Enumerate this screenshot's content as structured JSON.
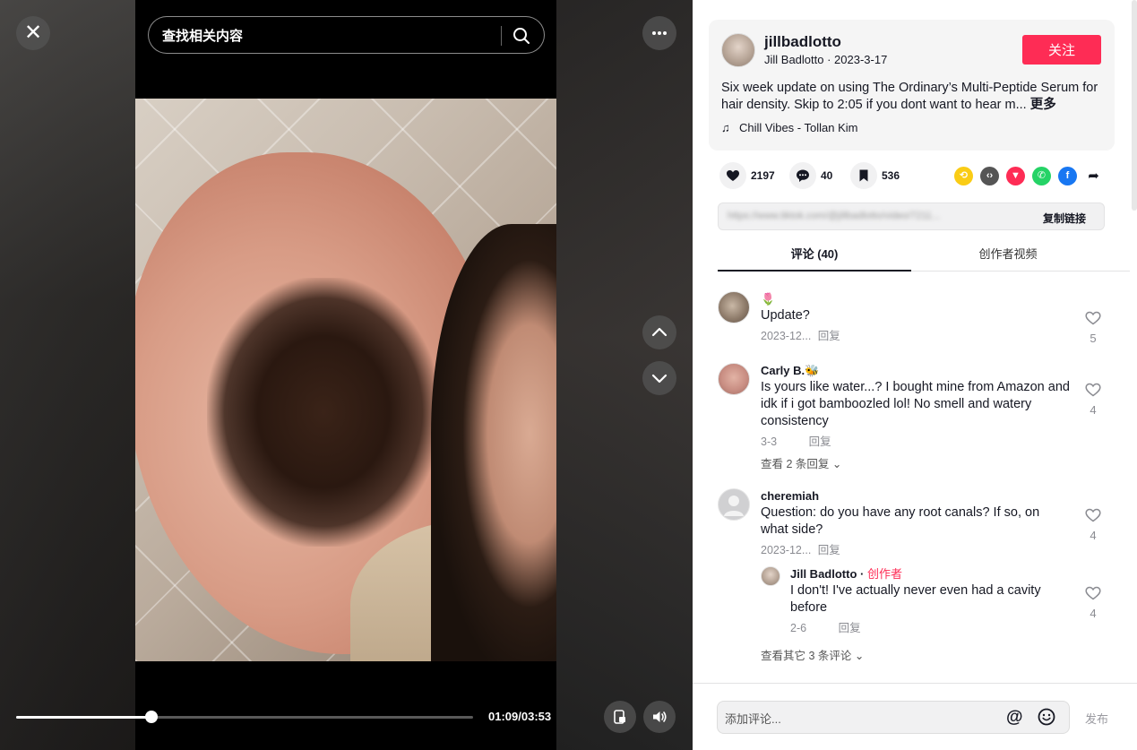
{
  "player": {
    "search_placeholder": "查找相关内容",
    "time": "01:09/03:53",
    "progress": 0.297
  },
  "author": {
    "username": "jillbadlotto",
    "subline": "Jill Badlotto · 2023-3-17",
    "follow_label": "关注",
    "description": "Six week update on using The Ordinary’s Multi-Peptide Serum for hair density. Skip to 2:05 if you dont want to hear m...",
    "more_label": "更多",
    "music": "Chill Vibes - Tollan Kim"
  },
  "stats": {
    "likes": "2197",
    "comments": "40",
    "saves": "536"
  },
  "share_icons": [
    {
      "name": "repost-icon",
      "color": "#facc15"
    },
    {
      "name": "embed-icon",
      "color": "#555555"
    },
    {
      "name": "send-icon",
      "color": "#fe2c55"
    },
    {
      "name": "whatsapp-icon",
      "color": "#25d366"
    },
    {
      "name": "facebook-icon",
      "color": "#1877f2"
    },
    {
      "name": "share-arrow-icon",
      "color": "#161823"
    }
  ],
  "link": {
    "url_text": "https://www.tiktok.com/@jillbadlotto/video/7211...",
    "copy_label": "复制链接"
  },
  "tabs": {
    "comments": "评论 (40)",
    "creator_videos": "创作者视频"
  },
  "comments": [
    {
      "name": "🌷",
      "text": "Update?",
      "date": "2023-12...",
      "reply_label": "回复",
      "likes": "5"
    },
    {
      "name": "Carly B.🐝",
      "text": "Is yours like water...? I bought mine from Amazon and idk if i got bamboozled lol! No smell and watery consistency",
      "date": "3-3",
      "reply_label": "回复",
      "likes": "4",
      "more": "查看 2 条回复"
    },
    {
      "name": "cheremiah",
      "text": "Question: do you have any root canals? If so, on what side?",
      "date": "2023-12...",
      "reply_label": "回复",
      "likes": "4",
      "more": "查看其它 3 条评论"
    }
  ],
  "reply": {
    "name": "Jill Badlotto",
    "tag": "创作者",
    "text": "I don't! I've actually never even had a cavity before",
    "date": "2-6",
    "reply_label": "回复",
    "likes": "4"
  },
  "comment_bar": {
    "placeholder": "添加评论...",
    "post_label": "发布"
  },
  "colors": {
    "accent": "#fe2c55",
    "text": "#161823",
    "muted": "#8a8b91"
  }
}
